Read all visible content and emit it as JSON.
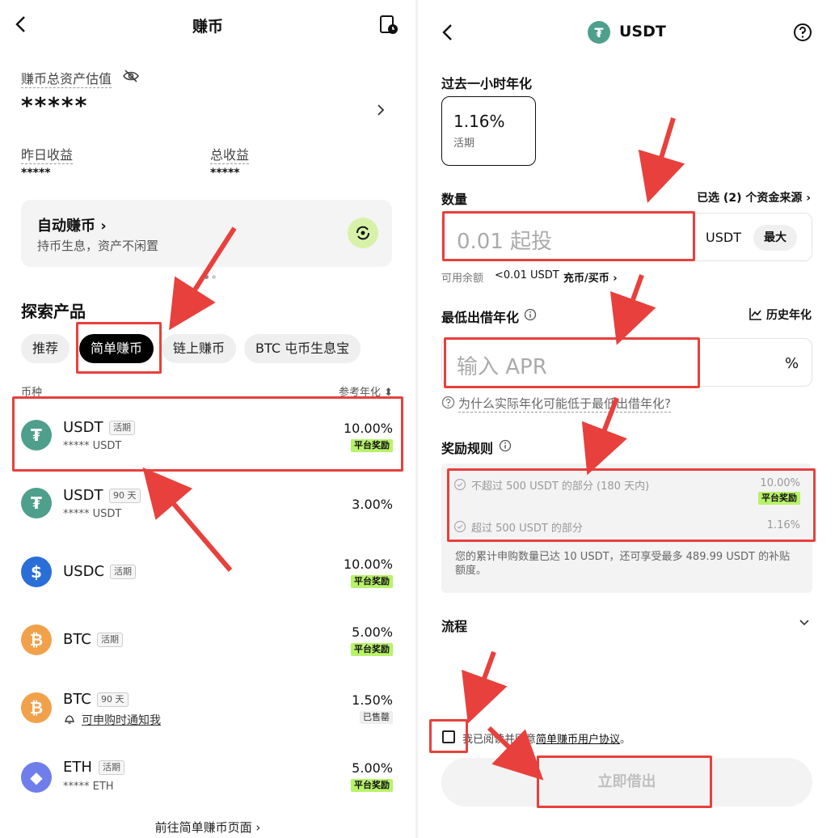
{
  "left": {
    "header": {
      "title": "赚币"
    },
    "assets": {
      "label": "赚币总资产估值",
      "value": "*****"
    },
    "yesterday": {
      "label": "昨日收益",
      "value": "*****"
    },
    "total": {
      "label": "总收益",
      "value": "*****"
    },
    "auto": {
      "title": "自动赚币 ›",
      "subtitle": "持币生息，资产不闲置"
    },
    "explore": {
      "title": "探索产品"
    },
    "tabs": [
      "推荐",
      "简单赚币",
      "链上赚币",
      "BTC 屯币生息宝"
    ],
    "columns": {
      "coin": "币种",
      "apr": "参考年化 ⬍"
    },
    "rows": [
      {
        "name": "USDT",
        "tag": "活期",
        "sub": "***** USDT",
        "rate": "10.00%",
        "badge": "平台奖励"
      },
      {
        "name": "USDT",
        "tag": "90 天",
        "sub": "***** USDT",
        "rate": "3.00%",
        "badge": ""
      },
      {
        "name": "USDC",
        "tag": "活期",
        "sub": "",
        "rate": "10.00%",
        "badge": "平台奖励"
      },
      {
        "name": "BTC",
        "tag": "活期",
        "sub": "",
        "rate": "5.00%",
        "badge": "平台奖励"
      },
      {
        "name": "BTC",
        "tag": "90 天",
        "sub": "可申购时通知我",
        "rate": "1.50%",
        "badge": "已售罄"
      },
      {
        "name": "ETH",
        "tag": "活期",
        "sub": "***** ETH",
        "rate": "5.00%",
        "badge": "平台奖励"
      }
    ],
    "footer_link": "前往简单赚币页面 ›"
  },
  "right": {
    "header": {
      "title": "USDT"
    },
    "past_hour": {
      "label": "过去一小时年化",
      "rate": "1.16%",
      "type": "活期"
    },
    "amount": {
      "label": "数量",
      "sources": "已选 (2) 个资金来源 ›",
      "placeholder": "0.01 起投",
      "unit": "USDT",
      "max": "最大",
      "available_label": "可用余额",
      "available_value": "<0.01 USDT",
      "topup": "充币/买币 ›"
    },
    "min_rate": {
      "label": "最低出借年化",
      "history": "历史年化",
      "placeholder": "输入 APR",
      "unit": "%",
      "why": "为什么实际年化可能低于最低出借年化?"
    },
    "rewards": {
      "label": "奖励规则",
      "tier1": "不超过 500 USDT 的部分 (180 天内)",
      "tier1_rate": "10.00%",
      "tier1_badge": "平台奖励",
      "tier2": "超过 500 USDT 的部分",
      "tier2_rate": "1.16%",
      "note": "您的累计申购数量已达 10 USDT，还可享受最多 489.99 USDT 的补贴额度。"
    },
    "process": {
      "label": "流程"
    },
    "agree": {
      "prefix": "我已阅读并同意",
      "link": "简单赚币用户协议",
      "suffix": "。"
    },
    "submit": "立即借出"
  },
  "colors": {
    "accent_green": "#b8f26a",
    "annotation_red": "#e8403c",
    "tether": "#4e9f8c"
  }
}
